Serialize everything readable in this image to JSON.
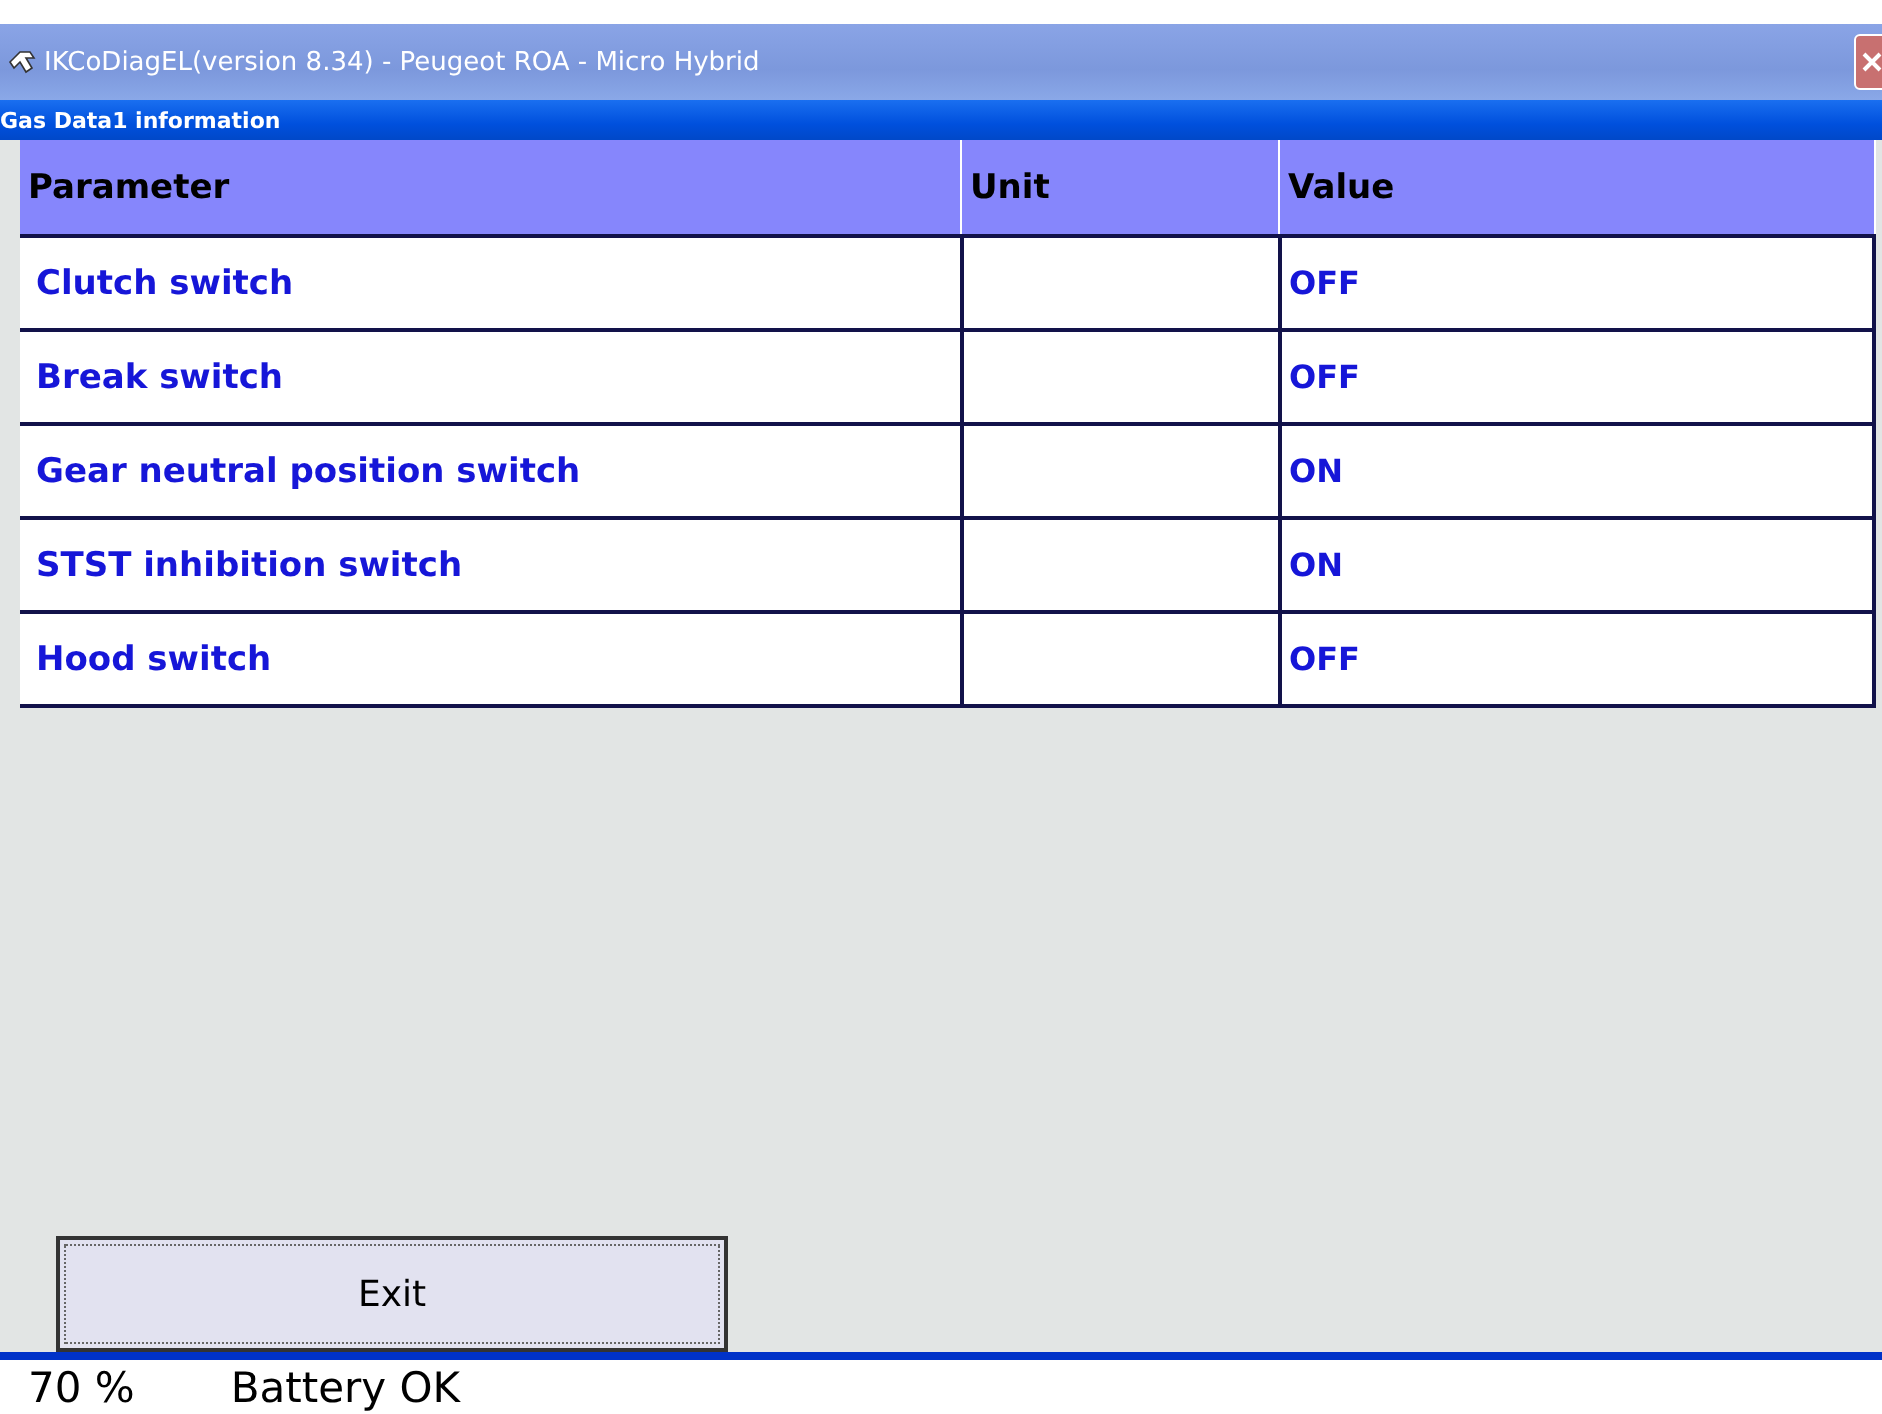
{
  "window": {
    "title": "IKCoDiagEL(version 8.34) - Peugeot ROA - Micro Hybrid"
  },
  "panel": {
    "title": "Gas Data1 information"
  },
  "table": {
    "columns": [
      "Parameter",
      "Unit",
      "Value"
    ],
    "rows": [
      {
        "parameter": "Clutch switch",
        "unit": "",
        "value": "OFF"
      },
      {
        "parameter": "Break switch",
        "unit": "",
        "value": "OFF"
      },
      {
        "parameter": "Gear neutral position switch",
        "unit": "",
        "value": "ON"
      },
      {
        "parameter": "STST inhibition switch",
        "unit": "",
        "value": "ON"
      },
      {
        "parameter": "Hood switch",
        "unit": "",
        "value": "OFF"
      }
    ]
  },
  "buttons": [
    "Exit"
  ],
  "status_bar": {
    "battery_percent": "70 %",
    "battery_status": "Battery OK"
  }
}
